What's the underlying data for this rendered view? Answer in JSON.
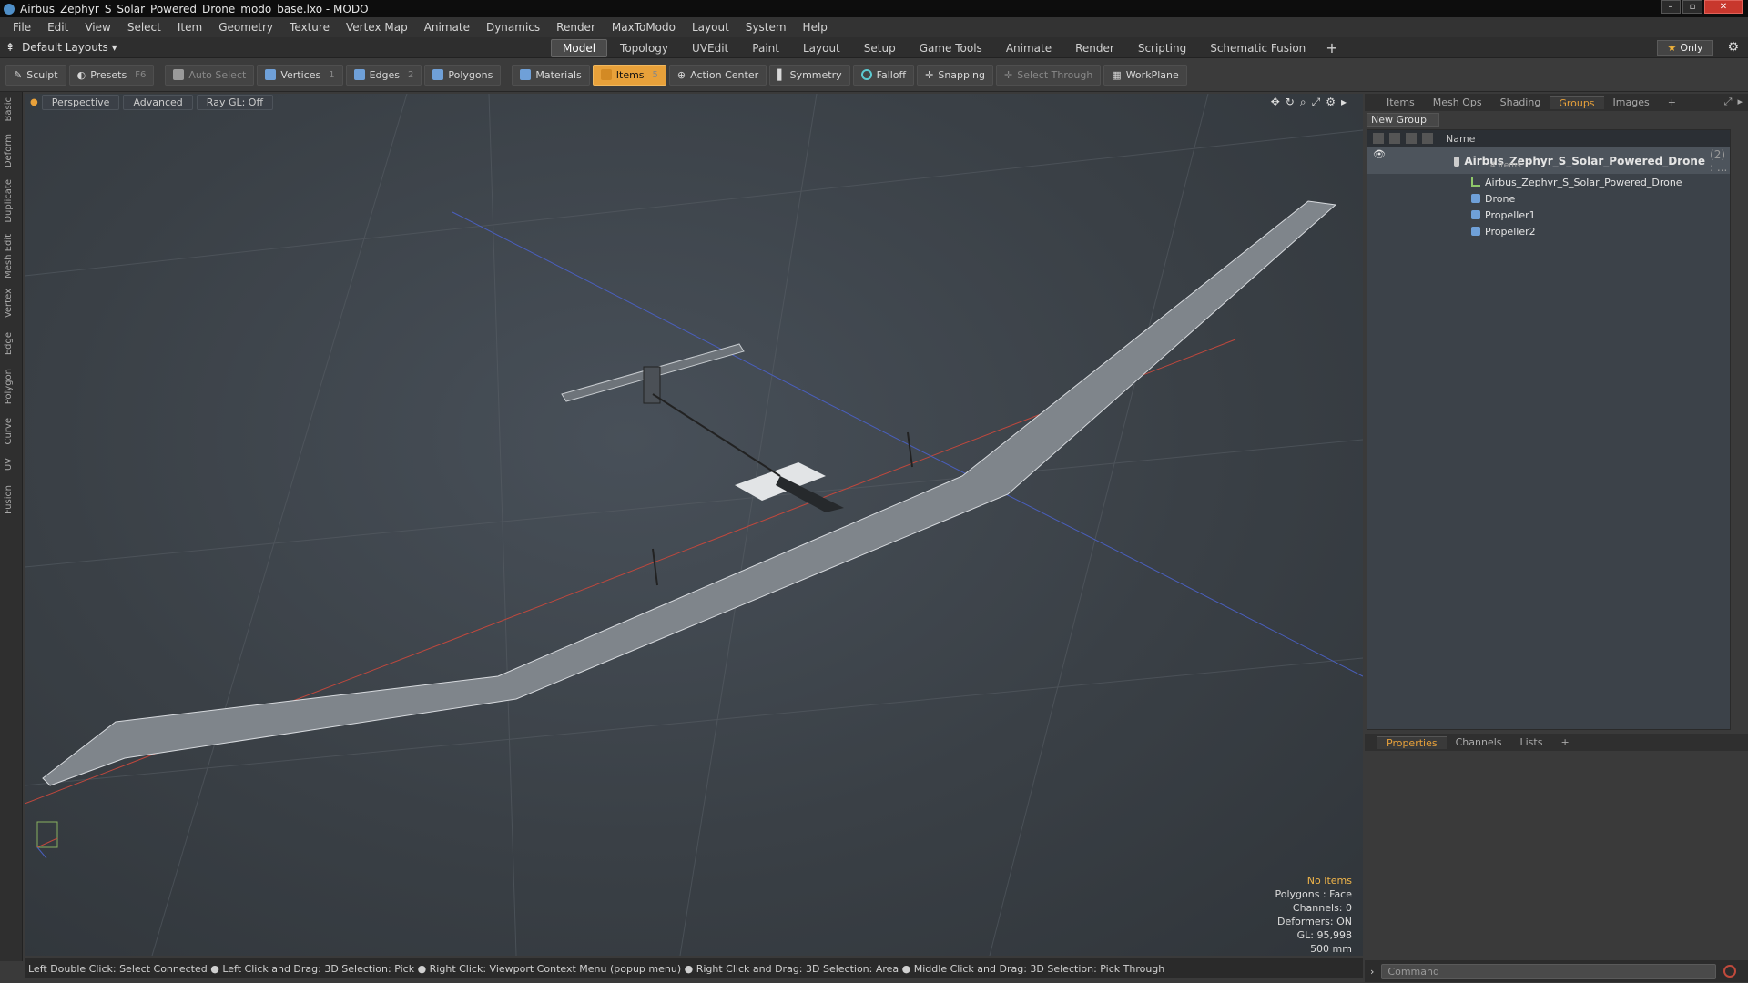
{
  "window": {
    "title": "Airbus_Zephyr_S_Solar_Powered_Drone_modo_base.lxo - MODO"
  },
  "menu": [
    "File",
    "Edit",
    "View",
    "Select",
    "Item",
    "Geometry",
    "Texture",
    "Vertex Map",
    "Animate",
    "Dynamics",
    "Render",
    "MaxToModo",
    "Layout",
    "System",
    "Help"
  ],
  "layouts": {
    "label": "Default Layouts ▾"
  },
  "tabs": [
    "Model",
    "Topology",
    "UVEdit",
    "Paint",
    "Layout",
    "Setup",
    "Game Tools",
    "Animate",
    "Render",
    "Scripting",
    "Schematic Fusion"
  ],
  "only_label": "Only",
  "toolbar": {
    "sculpt": "Sculpt",
    "presets": "Presets",
    "presets_key": "F6",
    "auto_select": "Auto Select",
    "vertices": "Vertices",
    "vertices_num": "1",
    "edges": "Edges",
    "edges_num": "2",
    "polygons": "Polygons",
    "materials": "Materials",
    "items": "Items",
    "items_num": "5",
    "action_center": "Action Center",
    "symmetry": "Symmetry",
    "falloff": "Falloff",
    "snapping": "Snapping",
    "select_through": "Select Through",
    "workplane": "WorkPlane"
  },
  "left_tabs": [
    "Basic",
    "Deform",
    "Duplicate",
    "Mesh Edit",
    "Vertex",
    "Edge",
    "Polygon",
    "Curve",
    "UV",
    "Fusion"
  ],
  "viewport": {
    "perspective": "Perspective",
    "advanced": "Advanced",
    "raygl": "Ray GL: Off",
    "info": {
      "no_items": "No Items",
      "polygons": "Polygons : Face",
      "channels": "Channels: 0",
      "deformers": "Deformers: ON",
      "gl": "GL: 95,998",
      "scale": "500 mm"
    }
  },
  "status": "Left Double Click: Select Connected ● Left Click and Drag: 3D Selection: Pick ● Right Click: Viewport Context Menu (popup menu) ● Right Click and Drag: 3D Selection: Area ● Middle Click and Drag: 3D Selection: Pick Through",
  "right_tabs": [
    "Items",
    "Mesh Ops",
    "Shading",
    "Groups",
    "Images"
  ],
  "new_group": "New Group",
  "tree": {
    "name_header": "Name",
    "group": {
      "name": "Airbus_Zephyr_S_Solar_Powered_Drone",
      "count": "(2) : ...",
      "items": "4 Items"
    },
    "children": [
      "Airbus_Zephyr_S_Solar_Powered_Drone",
      "Drone",
      "Propeller1",
      "Propeller2"
    ]
  },
  "bottom_tabs": [
    "Properties",
    "Channels",
    "Lists"
  ],
  "command_placeholder": "Command",
  "colors": {
    "accent": "#e8a13a",
    "viewport": "#3a4046"
  }
}
